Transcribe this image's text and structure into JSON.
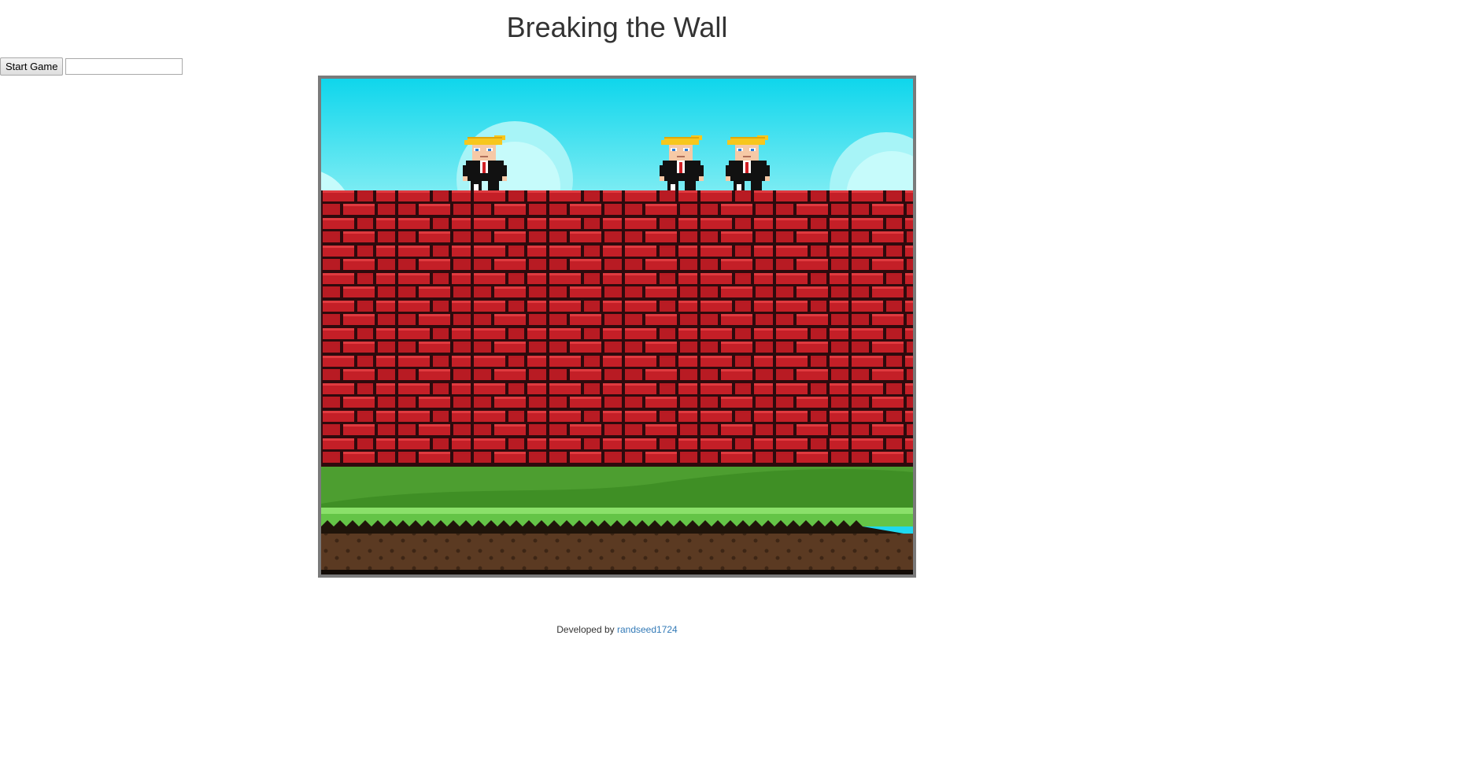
{
  "header": {
    "title": "Breaking the Wall"
  },
  "controls": {
    "start_label": "Start Game",
    "name_value": "",
    "name_placeholder": ""
  },
  "game": {
    "characters": [
      "character-1",
      "character-2",
      "character-3"
    ],
    "colors": {
      "sky_top": "#12d3ea",
      "sky_bottom": "#8ff0f5",
      "brick": "#c41f27",
      "mortar": "#3a0f12",
      "grass": "#4d9e30",
      "grass_top": "#7cd35a",
      "dirt": "#5a3a22"
    }
  },
  "footer": {
    "prefix": "Developed by ",
    "author": "randseed1724"
  }
}
